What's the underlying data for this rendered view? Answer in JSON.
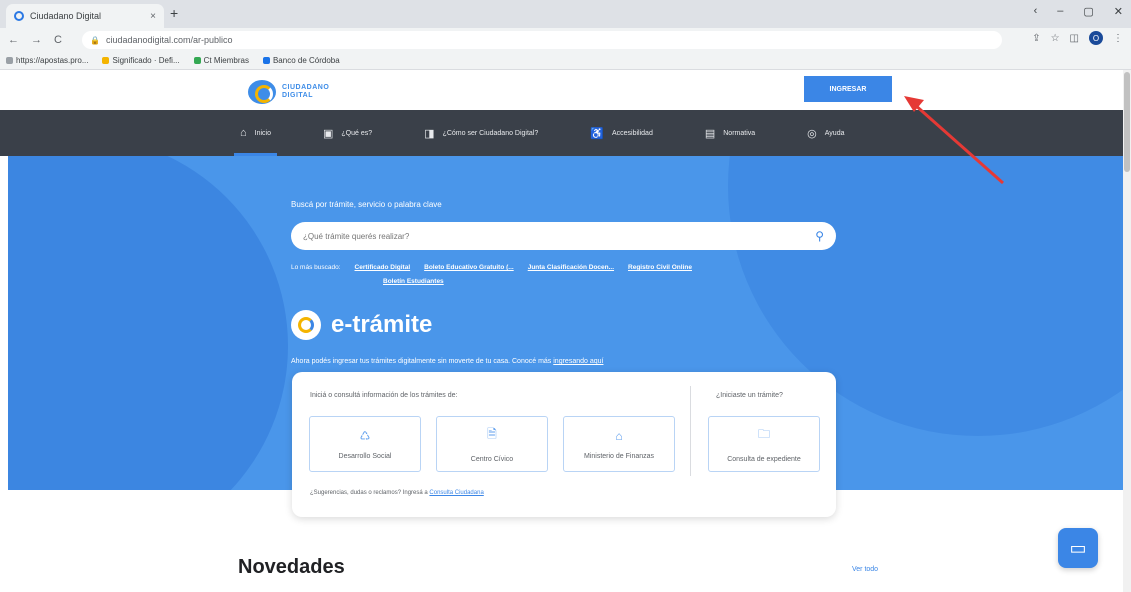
{
  "browser": {
    "tab_title": "Ciudadano Digital",
    "tab_close": "×",
    "new_tab": "+",
    "window_controls": [
      "‹",
      "–",
      "▢",
      "✕"
    ],
    "url": "ciudadanodigital.com/ar-publico",
    "nav_back": "←",
    "nav_forward": "→",
    "nav_reload": "C",
    "profile_initial": "O",
    "bookmarks": [
      {
        "label": "https://apostas.pro...",
        "color": "#9aa0a6"
      },
      {
        "label": "Significado · Defi...",
        "color": "#f4b400"
      },
      {
        "label": "Ct Miembras",
        "color": "#34a853"
      },
      {
        "label": "Banco de Córdoba",
        "color": "#1a73e8"
      }
    ]
  },
  "header": {
    "logo_line1": "CIUDADANO",
    "logo_line2": "DIGITAL",
    "login_button": "INGRESAR"
  },
  "nav": {
    "items": [
      {
        "icon": "⌂",
        "label": "Inicio"
      },
      {
        "icon": "▣",
        "label": "¿Qué es?"
      },
      {
        "icon": "◨",
        "label": "¿Cómo ser Ciudadano Digital?"
      },
      {
        "icon": "♿",
        "label": "Accesibilidad"
      },
      {
        "icon": "▤",
        "label": "Normativa"
      },
      {
        "icon": "◎",
        "label": "Ayuda"
      }
    ]
  },
  "hero": {
    "search_label": "Buscá por trámite, servicio o palabra clave",
    "search_placeholder": "¿Qué trámite querés realizar?",
    "popular_label": "Lo más buscado:",
    "popular_links": [
      "Certificado Digital",
      "Boleto Educativo Gratuito (...",
      "Junta Clasificación Docen...",
      "Registro Civil Online"
    ],
    "popular_link_2": "Boletín Estudiantes",
    "etramite_title": "e-trámite",
    "subtitle_text": "Ahora podés ingresar tus trámites digitalmente sin moverte de tu casa. Conocé más",
    "subtitle_link": "ingresando aquí"
  },
  "card": {
    "left_label": "Iniciá o consultá información de los trámites de:",
    "right_label": "¿Iniciaste un trámite?",
    "tiles": [
      {
        "icon": "♺",
        "label": "Desarrollo Social"
      },
      {
        "icon": "🗎",
        "label": "Centro Cívico"
      },
      {
        "icon": "⌂",
        "label": "Ministerio de Finanzas"
      }
    ],
    "right_tile": {
      "icon": "🗀",
      "label": "Consulta de expediente"
    },
    "footer_text": "¿Sugerencias, dudas o reclamos? Ingresá a",
    "footer_link": "Consulta Ciudadana"
  },
  "news": {
    "title": "Novedades",
    "see_all": "Ver todo"
  },
  "chat": {
    "icon": "▭"
  },
  "colors": {
    "primary": "#3b86e6",
    "nav_bg": "#3a4049",
    "hero_bg": "#4a96ea",
    "annotation_arrow": "#e53935"
  }
}
